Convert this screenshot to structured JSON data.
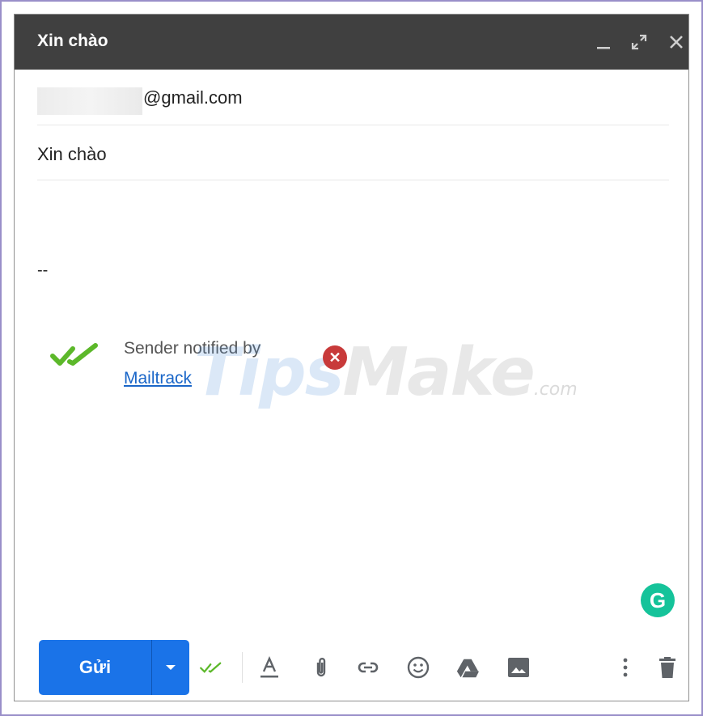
{
  "window": {
    "title": "Xin chào"
  },
  "compose": {
    "to_suffix": "@gmail.com",
    "subject": "Xin chào",
    "body_signature_separator": "--",
    "signature": {
      "text": "Sender notified by",
      "link": "Mailtrack"
    }
  },
  "watermark": {
    "brand_part1": "Tips",
    "brand_part2": "Make",
    "suffix": ".com"
  },
  "grammarly": {
    "letter": "G"
  },
  "toolbar": {
    "send_label": "Gửi"
  },
  "colors": {
    "titlebar": "#404040",
    "send_button": "#1a73e8",
    "mailtrack_check": "#5cb82a",
    "grammarly": "#15c39a",
    "link": "#1a66c8"
  },
  "icons": {
    "minimize": "minimize-icon",
    "fullscreen": "fullscreen-icon",
    "close": "close-icon",
    "mailtrack": "double-check-icon",
    "formatting": "text-format-icon",
    "attach": "paperclip-icon",
    "link": "link-icon",
    "emoji": "emoji-icon",
    "drive": "google-drive-icon",
    "photo": "photo-icon",
    "more": "more-vert-icon",
    "discard": "trash-icon"
  }
}
